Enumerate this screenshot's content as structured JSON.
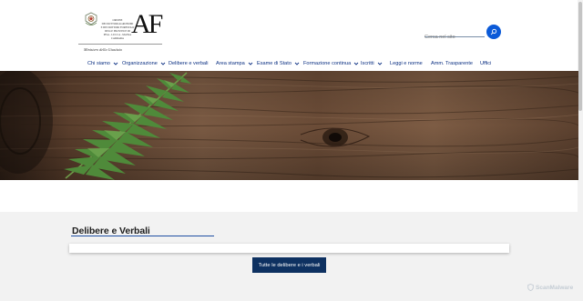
{
  "header": {
    "logo": {
      "org_lines": [
        "ORDINE",
        "DEI DOTTORI AGRONOMI",
        "E DEI DOTTORI FORESTALI",
        "DELLE PROVINCE DI",
        "PISA - LUCCA - MASSA CARRARA"
      ],
      "mark": "AF",
      "ministry": "Ministero della Giustizia"
    },
    "search": {
      "placeholder": "Cerca nel sito"
    }
  },
  "nav": {
    "items": [
      {
        "label": "Chi siamo",
        "dropdown": true
      },
      {
        "label": "Organizzazione",
        "dropdown": true
      },
      {
        "label": "Delibere e verbali",
        "dropdown": false
      },
      {
        "label": "Area stampa",
        "dropdown": true
      },
      {
        "label": "Esame di Stato",
        "dropdown": true
      },
      {
        "label": "Formazione continua",
        "dropdown": true
      },
      {
        "label": "Iscritti",
        "dropdown": true
      },
      {
        "label": "Leggi e norme",
        "dropdown": false
      },
      {
        "label": "Amm. Trasparente",
        "dropdown": false
      },
      {
        "label": "Uffici",
        "dropdown": false
      }
    ]
  },
  "section": {
    "title": "Delibere e Verbali",
    "button_label": "Tutte le delibere e i verbali"
  },
  "watermark": {
    "text": "ScanMalware"
  },
  "colors": {
    "primary": "#0b5ad8",
    "nav_text": "#0a2f82",
    "button_bg": "#0e3161",
    "section_bg": "#f2f2f2"
  }
}
